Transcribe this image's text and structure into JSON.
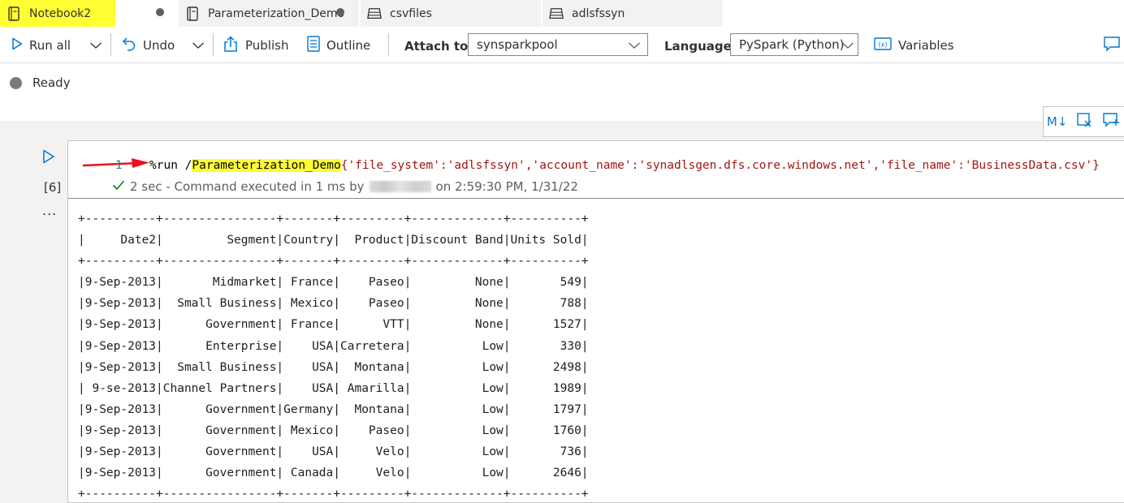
{
  "tabs": [
    {
      "label": "Notebook2",
      "icon": "notebook-icon",
      "active": true,
      "highlight": "#ffff33"
    },
    {
      "label": "Parameterization_Demo",
      "icon": "notebook-icon"
    },
    {
      "label": "csvfiles",
      "icon": "dataset-icon"
    },
    {
      "label": "adlsfssyn",
      "icon": "dataset-icon"
    }
  ],
  "toolbar": {
    "run_all": "Run all",
    "undo": "Undo",
    "publish": "Publish",
    "outline": "Outline",
    "attach_to_label": "Attach to",
    "attach_to_value": "synsparkpool",
    "language_label": "Language",
    "language_value": "PySpark (Python)",
    "variables": "Variables"
  },
  "status": {
    "text": "Ready"
  },
  "cell": {
    "execution_count": "[6]",
    "more": "...",
    "line_number": "1",
    "code_prefix": "%run /",
    "code_highlight": "Parameterization_Demo",
    "code_suffix": "{'file_system':'adlsfssyn','account_name':'synadlsgen.dfs.core.windows.net','file_name':'BusinessData.csv'}",
    "exec_time": "2 sec - Command executed in 1 ms by",
    "exec_when": "on 2:59:30 PM, 1/31/22",
    "toolbar_buttons": [
      "M↓"
    ]
  },
  "output": {
    "columns": [
      "Date2",
      "Segment",
      "Country",
      "Product",
      "Discount Band",
      "Units Sold"
    ],
    "rows": [
      [
        "9-Sep-2013",
        "Midmarket",
        "France",
        "Paseo",
        "None",
        "549"
      ],
      [
        "9-Sep-2013",
        "Small Business",
        "Mexico",
        "Paseo",
        "None",
        "788"
      ],
      [
        "9-Sep-2013",
        "Government",
        "France",
        "VTT",
        "None",
        "1527"
      ],
      [
        "9-Sep-2013",
        "Enterprise",
        "USA",
        "Carretera",
        "Low",
        "330"
      ],
      [
        "9-Sep-2013",
        "Small Business",
        "USA",
        "Montana",
        "Low",
        "2498"
      ],
      [
        "9-se-2013",
        "Channel Partners",
        "USA",
        "Amarilla",
        "Low",
        "1989"
      ],
      [
        "9-Sep-2013",
        "Government",
        "Germany",
        "Montana",
        "Low",
        "1797"
      ],
      [
        "9-Sep-2013",
        "Government",
        "Mexico",
        "Paseo",
        "Low",
        "1760"
      ],
      [
        "9-Sep-2013",
        "Government",
        "USA",
        "Velo",
        "Low",
        "736"
      ],
      [
        "9-Sep-2013",
        "Government",
        "Canada",
        "Velo",
        "Low",
        "2646"
      ]
    ]
  },
  "colors": {
    "accent": "#0078d4",
    "highlight": "#ffff33",
    "annotation_arrow": "#e81123"
  }
}
